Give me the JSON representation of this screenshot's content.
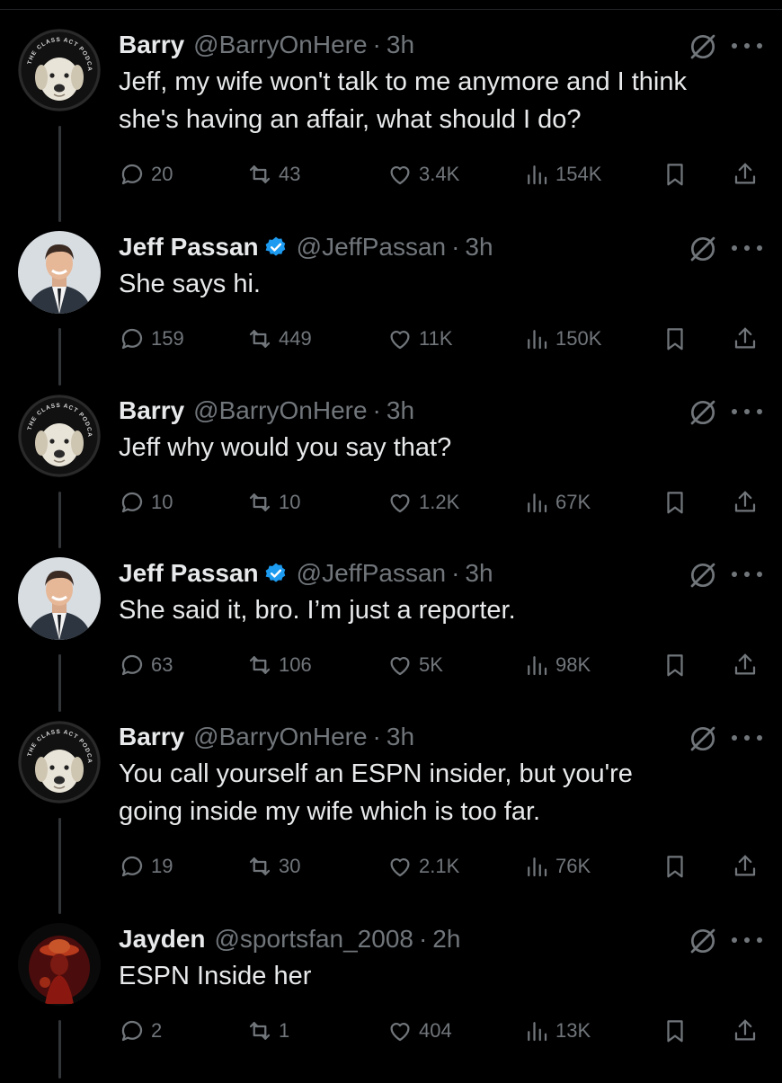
{
  "tweets": [
    {
      "name": "Barry",
      "verified": false,
      "handle": "@BarryOnHere",
      "time": "3h",
      "avatar": "dog",
      "lines": [
        "Jeff, my wife won't talk to me anymore and I think",
        "she's having an affair, what should I do?"
      ],
      "replies": "20",
      "reposts": "43",
      "likes": "3.4K",
      "views": "154K"
    },
    {
      "name": "Jeff Passan",
      "verified": true,
      "handle": "@JeffPassan",
      "time": "3h",
      "avatar": "man",
      "lines": [
        "She says hi."
      ],
      "replies": "159",
      "reposts": "449",
      "likes": "11K",
      "views": "150K"
    },
    {
      "name": "Barry",
      "verified": false,
      "handle": "@BarryOnHere",
      "time": "3h",
      "avatar": "dog",
      "lines": [
        "Jeff why would you say that?"
      ],
      "replies": "10",
      "reposts": "10",
      "likes": "1.2K",
      "views": "67K"
    },
    {
      "name": "Jeff Passan",
      "verified": true,
      "handle": "@JeffPassan",
      "time": "3h",
      "avatar": "man",
      "lines": [
        "She said it, bro. I’m just a reporter."
      ],
      "replies": "63",
      "reposts": "106",
      "likes": "5K",
      "views": "98K"
    },
    {
      "name": "Barry",
      "verified": false,
      "handle": "@BarryOnHere",
      "time": "3h",
      "avatar": "dog",
      "lines": [
        "You call yourself an ESPN insider, but you're",
        "going inside my wife which is too far."
      ],
      "replies": "19",
      "reposts": "30",
      "likes": "2.1K",
      "views": "76K"
    },
    {
      "name": "Jayden",
      "verified": false,
      "handle": "@sportsfan_2008",
      "time": "2h",
      "avatar": "red-figure",
      "lines": [
        "ESPN Inside her"
      ],
      "replies": "2",
      "reposts": "1",
      "likes": "404",
      "views": "13K"
    }
  ],
  "icons": {
    "reply": "reply-icon",
    "repost": "repost-icon",
    "like": "heart-icon",
    "views": "views-icon",
    "bookmark": "bookmark-icon",
    "share": "share-icon",
    "grok": "grok-icon",
    "more": "more-icon",
    "verified": "verified-badge-icon"
  },
  "colors": {
    "background": "#000000",
    "text": "#e7e9ea",
    "muted": "#71767b",
    "verified": "#1d9bf0"
  },
  "avatar_text": {
    "dog": "THE CLASS ACT PODCAST"
  }
}
